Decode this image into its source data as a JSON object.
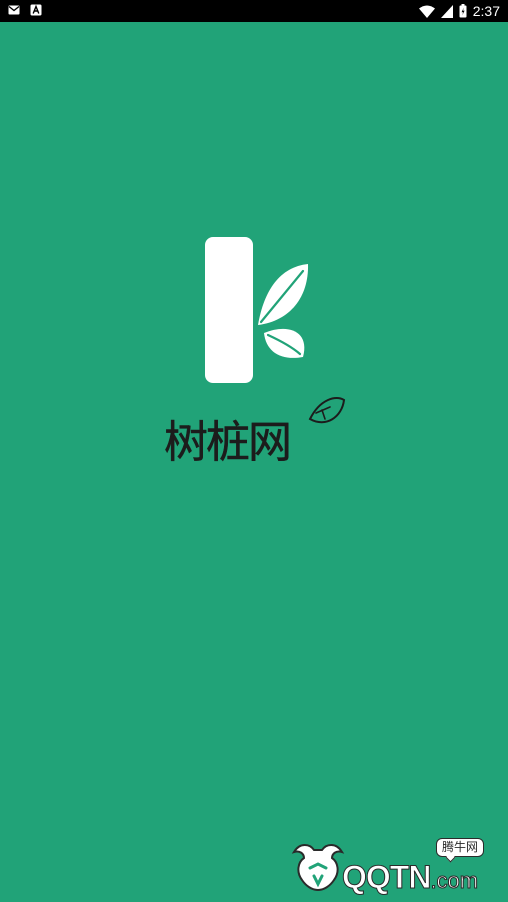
{
  "status_bar": {
    "time": "2:37",
    "left_icons": [
      "mail-icon",
      "app-a-icon"
    ],
    "right_icons": [
      "wifi-icon",
      "signal-icon",
      "battery-icon"
    ]
  },
  "splash": {
    "brand_name": "树桩网",
    "logo_icon": "tree-stump-k-logo-icon"
  },
  "watermark": {
    "text": "QQTN",
    "suffix": ".com",
    "badge": "腾牛网"
  },
  "colors": {
    "background": "#21a378",
    "logo_white": "#ffffff",
    "brand_text": "#1c1c1c"
  }
}
